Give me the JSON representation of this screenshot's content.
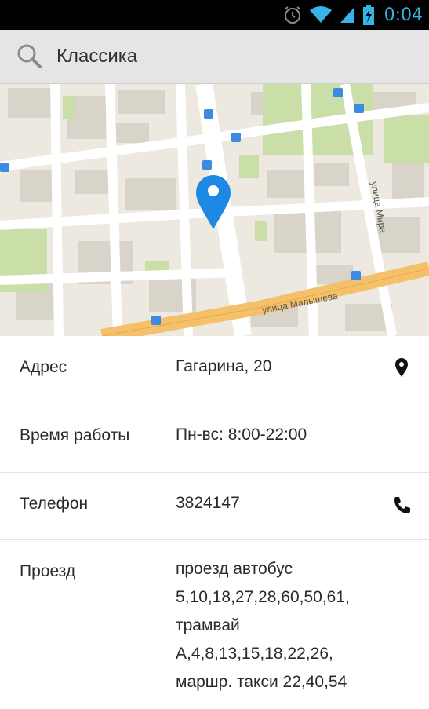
{
  "status_bar": {
    "time": "0:04",
    "icons": [
      "alarm-icon",
      "wifi-icon",
      "signal-icon",
      "battery-charging-icon"
    ]
  },
  "app_bar": {
    "title": "Классика",
    "icon": "search-icon"
  },
  "map": {
    "street_labels": [
      "улица Малышева",
      "улица Мира"
    ],
    "marker": "location-pin-icon"
  },
  "details": [
    {
      "label": "Адрес",
      "value": "Гагарина, 20",
      "action_icon": "map-pin-icon"
    },
    {
      "label": "Время работы",
      "value": "Пн-вс: 8:00-22:00"
    },
    {
      "label": "Телефон",
      "value": "3824147",
      "action_icon": "phone-icon"
    },
    {
      "label": "Проезд",
      "value": "проезд автобус 5,10,18,27,28,60,50,61, трамвай А,4,8,13,15,18,22,26, маршр. такси 22,40,54"
    }
  ],
  "colors": {
    "status_bar_bg": "#000000",
    "clock": "#33b5e5",
    "app_bar_bg": "#e5e5e5",
    "marker": "#1e88e5",
    "main_road": "#f5c06a",
    "park": "#c9dfa7",
    "building": "#d9d4ca"
  }
}
